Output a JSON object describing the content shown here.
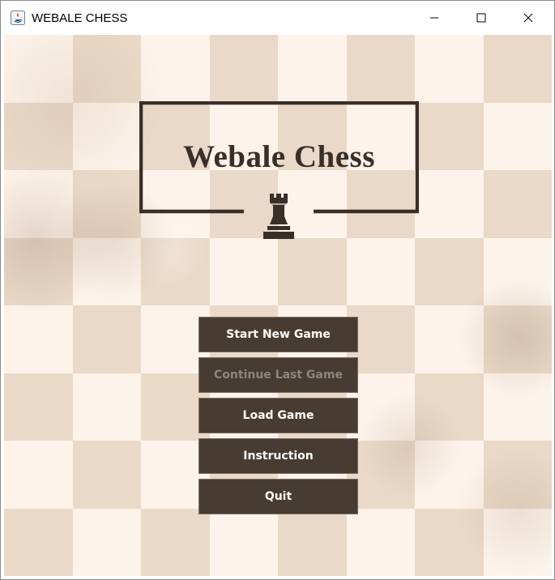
{
  "window": {
    "title": "WEBALE CHESS",
    "controls": [
      "minimize-icon",
      "maximize-icon",
      "close-icon"
    ]
  },
  "logo": {
    "title": "Webale Chess",
    "icon": "rook-icon"
  },
  "menu": {
    "items": [
      {
        "label": "Start New Game",
        "enabled": true
      },
      {
        "label": "Continue Last Game",
        "enabled": false
      },
      {
        "label": "Load Game",
        "enabled": true
      },
      {
        "label": "Instruction",
        "enabled": true
      },
      {
        "label": "Quit",
        "enabled": true
      }
    ]
  },
  "colors": {
    "button_bg": "#483c32",
    "button_text": "#ffffff",
    "button_disabled_text": "#8e857d",
    "logo_ink": "#3a2f28",
    "light_square": "#fdf3ea",
    "dark_square": "#ead9c8"
  }
}
